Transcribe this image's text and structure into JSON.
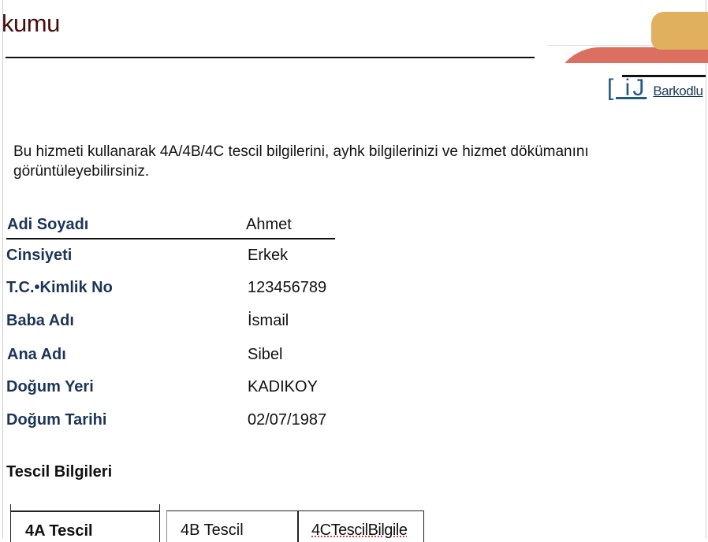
{
  "header": {
    "title": "kumu",
    "barcode_icon": "[ iJ",
    "barcode_link": "Barkodlu"
  },
  "intro": {
    "text": "Bu hizmeti kullanarak 4A/4B/4C tescil bilgilerini, ayhk bilgilerinizi ve hizmet dökümanını görüntüleyebilirsiniz."
  },
  "personal_info": [
    {
      "label": "Adi Soyadı",
      "value": "Ahmet"
    },
    {
      "label": "Cinsiyeti",
      "value": "Erkek"
    },
    {
      "label": "T.C.•Kimlik No",
      "value": "123456789"
    },
    {
      "label": "Baba Adı",
      "value": "İsmail"
    },
    {
      "label": "Ana Adı",
      "value": "Sibel"
    },
    {
      "label": "Doğum Yeri",
      "value": "KADIKOY"
    },
    {
      "label": "Doğum Tarihi",
      "value": "02/07/1987"
    }
  ],
  "tescil": {
    "section_title": "Tescil Bilgileri",
    "tabs": [
      {
        "label": "4A Tescil"
      },
      {
        "label": "4B Tescil"
      },
      {
        "label": "4CTescilBilgile"
      }
    ]
  },
  "colors": {
    "title": "#4a0d0d",
    "label": "#1c3557",
    "link": "#1b3a5a",
    "deco_red": "#dc7060",
    "deco_gold": "#e1b05f"
  }
}
